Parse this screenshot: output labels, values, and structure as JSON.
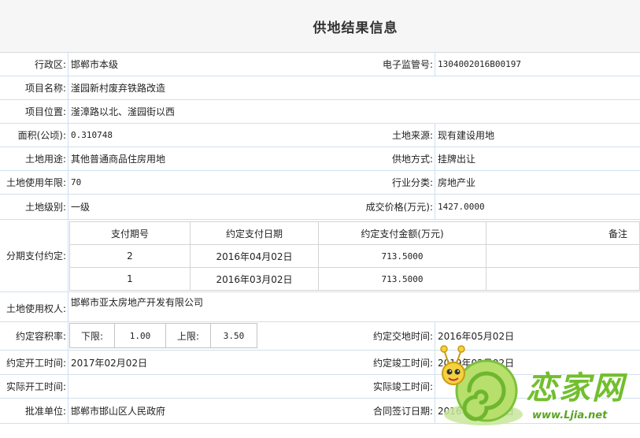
{
  "page": {
    "title": "供地结果信息"
  },
  "fields": {
    "district": {
      "label": "行政区:",
      "value": "邯郸市本级"
    },
    "supervision_no": {
      "label": "电子监管号:",
      "value": "1304002016B00197"
    },
    "project_name": {
      "label": "项目名称:",
      "value": "滏园新村废弃铁路改造"
    },
    "project_location": {
      "label": "项目位置:",
      "value": "滏漳路以北、滏园街以西"
    },
    "area": {
      "label": "面积(公顷):",
      "value": "0.310748"
    },
    "land_source": {
      "label": "土地来源:",
      "value": "现有建设用地"
    },
    "land_use": {
      "label": "土地用途:",
      "value": "其他普通商品住房用地"
    },
    "supply_method": {
      "label": "供地方式:",
      "value": "挂牌出让"
    },
    "use_term": {
      "label": "土地使用年限:",
      "value": "70"
    },
    "industry": {
      "label": "行业分类:",
      "value": "房地产业"
    },
    "land_grade": {
      "label": "土地级别:",
      "value": "一级"
    },
    "deal_price": {
      "label": "成交价格(万元):",
      "value": "1427.0000"
    },
    "installments": {
      "label": "分期支付约定:",
      "headers": [
        "支付期号",
        "约定支付日期",
        "约定支付金额(万元)",
        "备注"
      ],
      "rows": [
        {
          "period": "2",
          "date": "2016年04月02日",
          "amount": "713.5000",
          "note": ""
        },
        {
          "period": "1",
          "date": "2016年03月02日",
          "amount": "713.5000",
          "note": ""
        }
      ]
    },
    "land_user": {
      "label": "土地使用权人:",
      "value": "邯郸市亚太房地产开发有限公司"
    },
    "plot_ratio": {
      "label": "约定容积率:",
      "lower_label": "下限:",
      "lower_value": "1.00",
      "upper_label": "上限:",
      "upper_value": "3.50"
    },
    "handover_time": {
      "label": "约定交地时间:",
      "value": "2016年05月02日"
    },
    "agreed_start": {
      "label": "约定开工时间:",
      "value": "2017年02月02日"
    },
    "agreed_completion": {
      "label": "约定竣工时间:",
      "value": "2019年02月02日"
    },
    "actual_start": {
      "label": "实际开工时间:",
      "value": ""
    },
    "actual_completion": {
      "label": "实际竣工时间:",
      "value": ""
    },
    "approval_unit": {
      "label": "批准单位:",
      "value": "邯郸市邯山区人民政府"
    },
    "contract_date": {
      "label": "合同签订日期:",
      "value": "2016年02月02日"
    }
  },
  "watermark": {
    "text": "恋家网",
    "url": "www.Ljia.net",
    "accent": "#72bf2e"
  }
}
